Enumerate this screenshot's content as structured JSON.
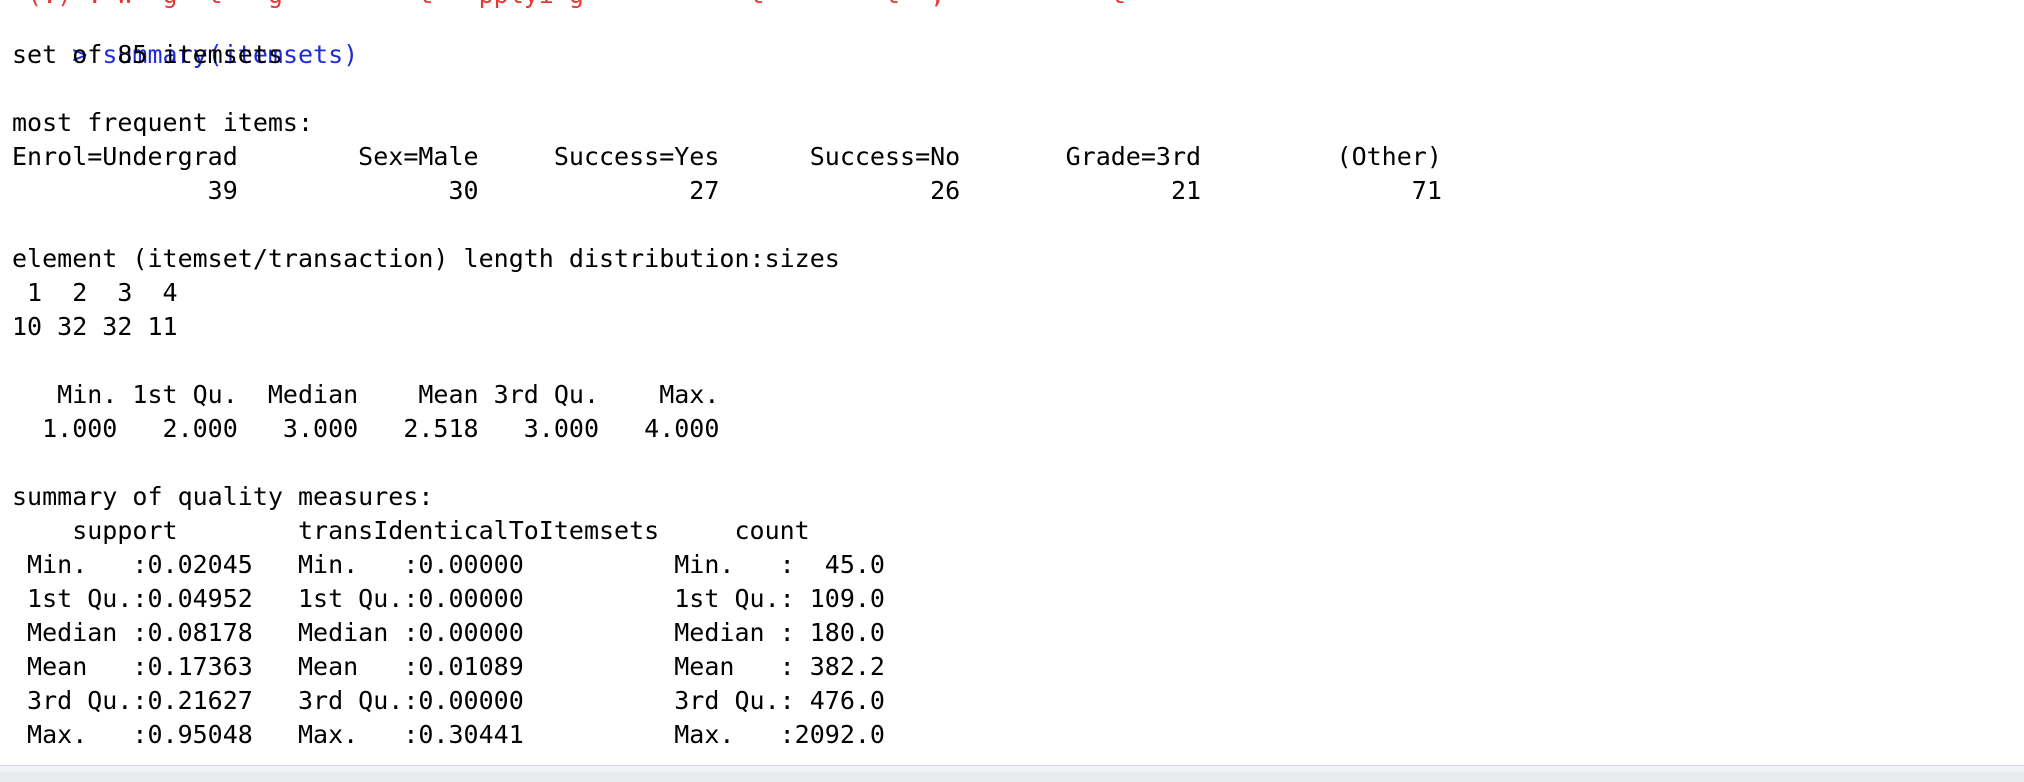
{
  "console": {
    "previous_line_fragment": " (.) : W  g  t   g         t   pplyi g           t        t  ,           t       ",
    "prompt": "> ",
    "command": "summary(itemsets)",
    "output": [
      "set of 85 itemsets",
      "",
      "most frequent items:",
      "Enrol=Undergrad        Sex=Male     Success=Yes      Success=No       Grade=3rd         (Other) ",
      "             39              30              27              26              21              71 ",
      "",
      "element (itemset/transaction) length distribution:sizes",
      " 1  2  3  4 ",
      "10 32 32 11 ",
      "",
      "   Min. 1st Qu.  Median    Mean 3rd Qu.    Max. ",
      "  1.000   2.000   3.000   2.518   3.000   4.000 ",
      "",
      "summary of quality measures:",
      "    support        transIdenticalToItemsets     count      ",
      " Min.   :0.02045   Min.   :0.00000          Min.   :  45.0  ",
      " 1st Qu.:0.04952   1st Qu.:0.00000          1st Qu.: 109.0  ",
      " Median :0.08178   Median :0.00000          Median : 180.0  ",
      " Mean   :0.17363   Mean   :0.01089          Mean   : 382.2  ",
      " 3rd Qu.:0.21627   3rd Qu.:0.00000          3rd Qu.: 476.0  ",
      " Max.   :0.95048   Max.   :0.30441          Max.   :2092.0  "
    ]
  },
  "colors": {
    "command": "#1f2bd9",
    "warning": "#e53935",
    "output": "#000000",
    "background": "#ffffff"
  }
}
